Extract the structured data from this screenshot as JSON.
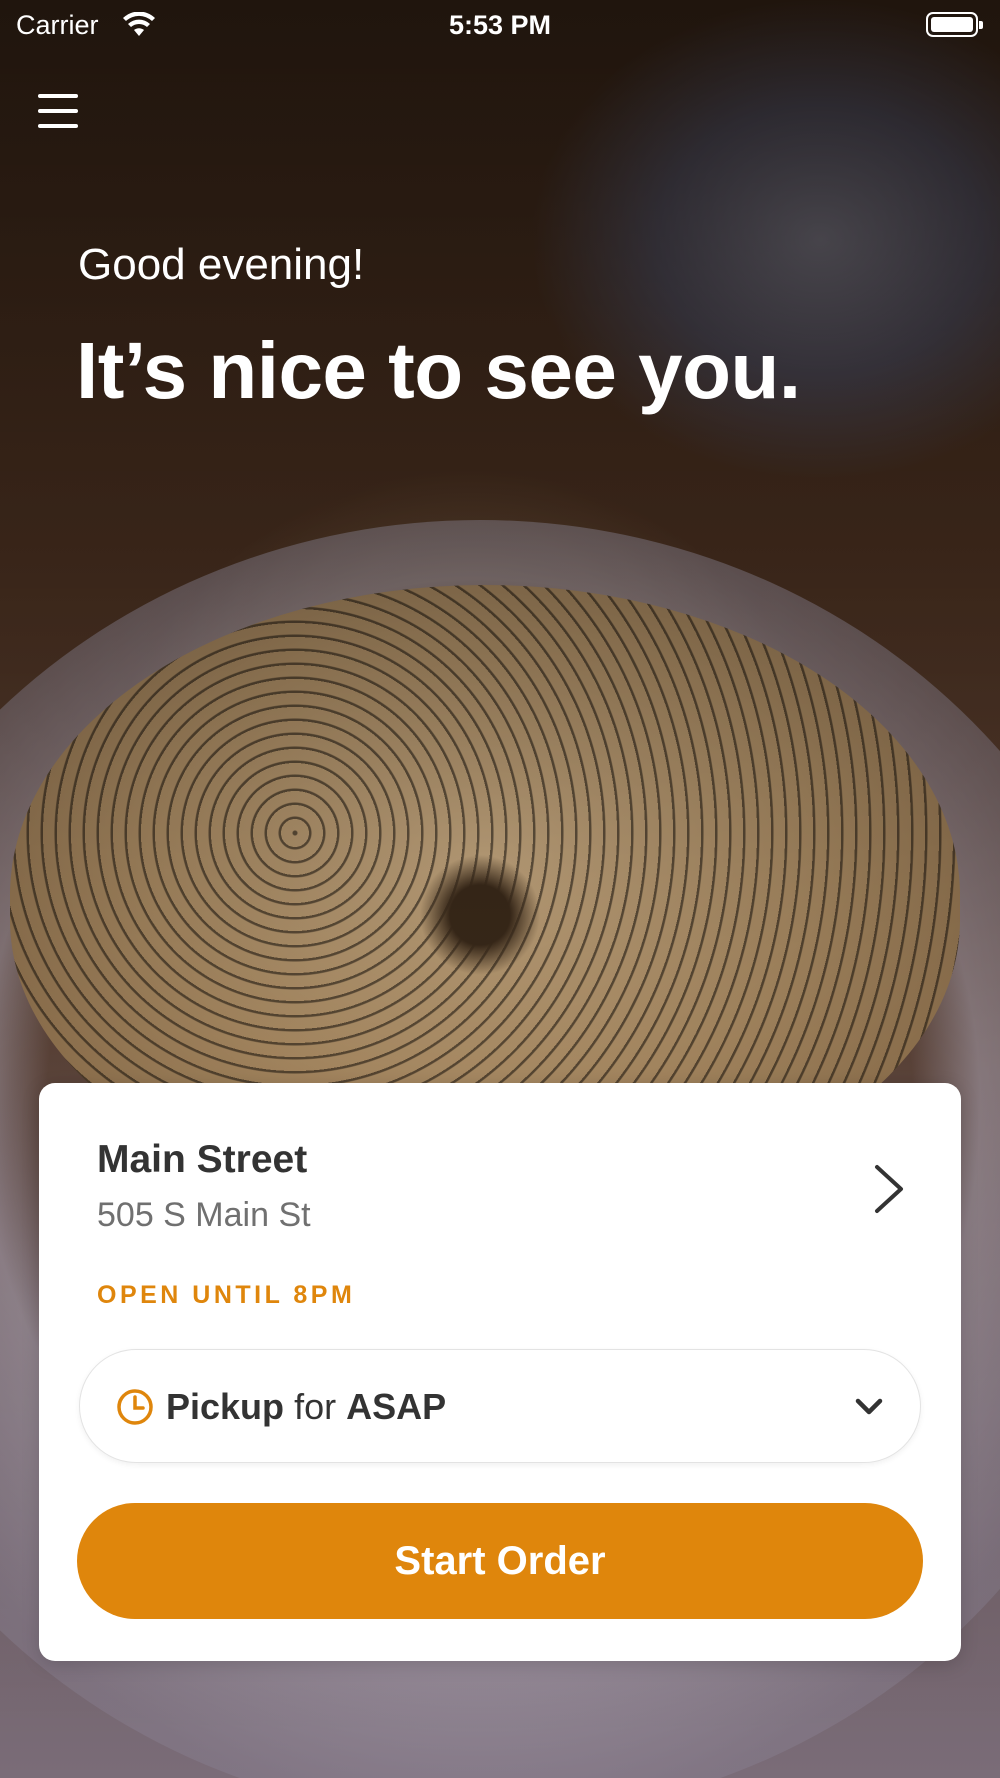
{
  "status_bar": {
    "carrier": "Carrier",
    "time": "5:53 PM",
    "wifi_icon": "wifi-icon",
    "battery_icon": "battery-icon"
  },
  "header": {
    "menu_icon": "hamburger-menu-icon",
    "greeting": "Good evening!",
    "headline": "It’s nice to see you."
  },
  "location_card": {
    "store_name": "Main Street",
    "store_address": "505 S Main St",
    "hours": "OPEN UNTIL 8PM",
    "order_mode": {
      "method": "Pickup",
      "connector": "for",
      "time": "ASAP"
    },
    "start_order_label": "Start Order"
  },
  "colors": {
    "accent": "#df860c",
    "card_background": "#ffffff",
    "primary_text": "#333333",
    "secondary_text": "#707070"
  }
}
